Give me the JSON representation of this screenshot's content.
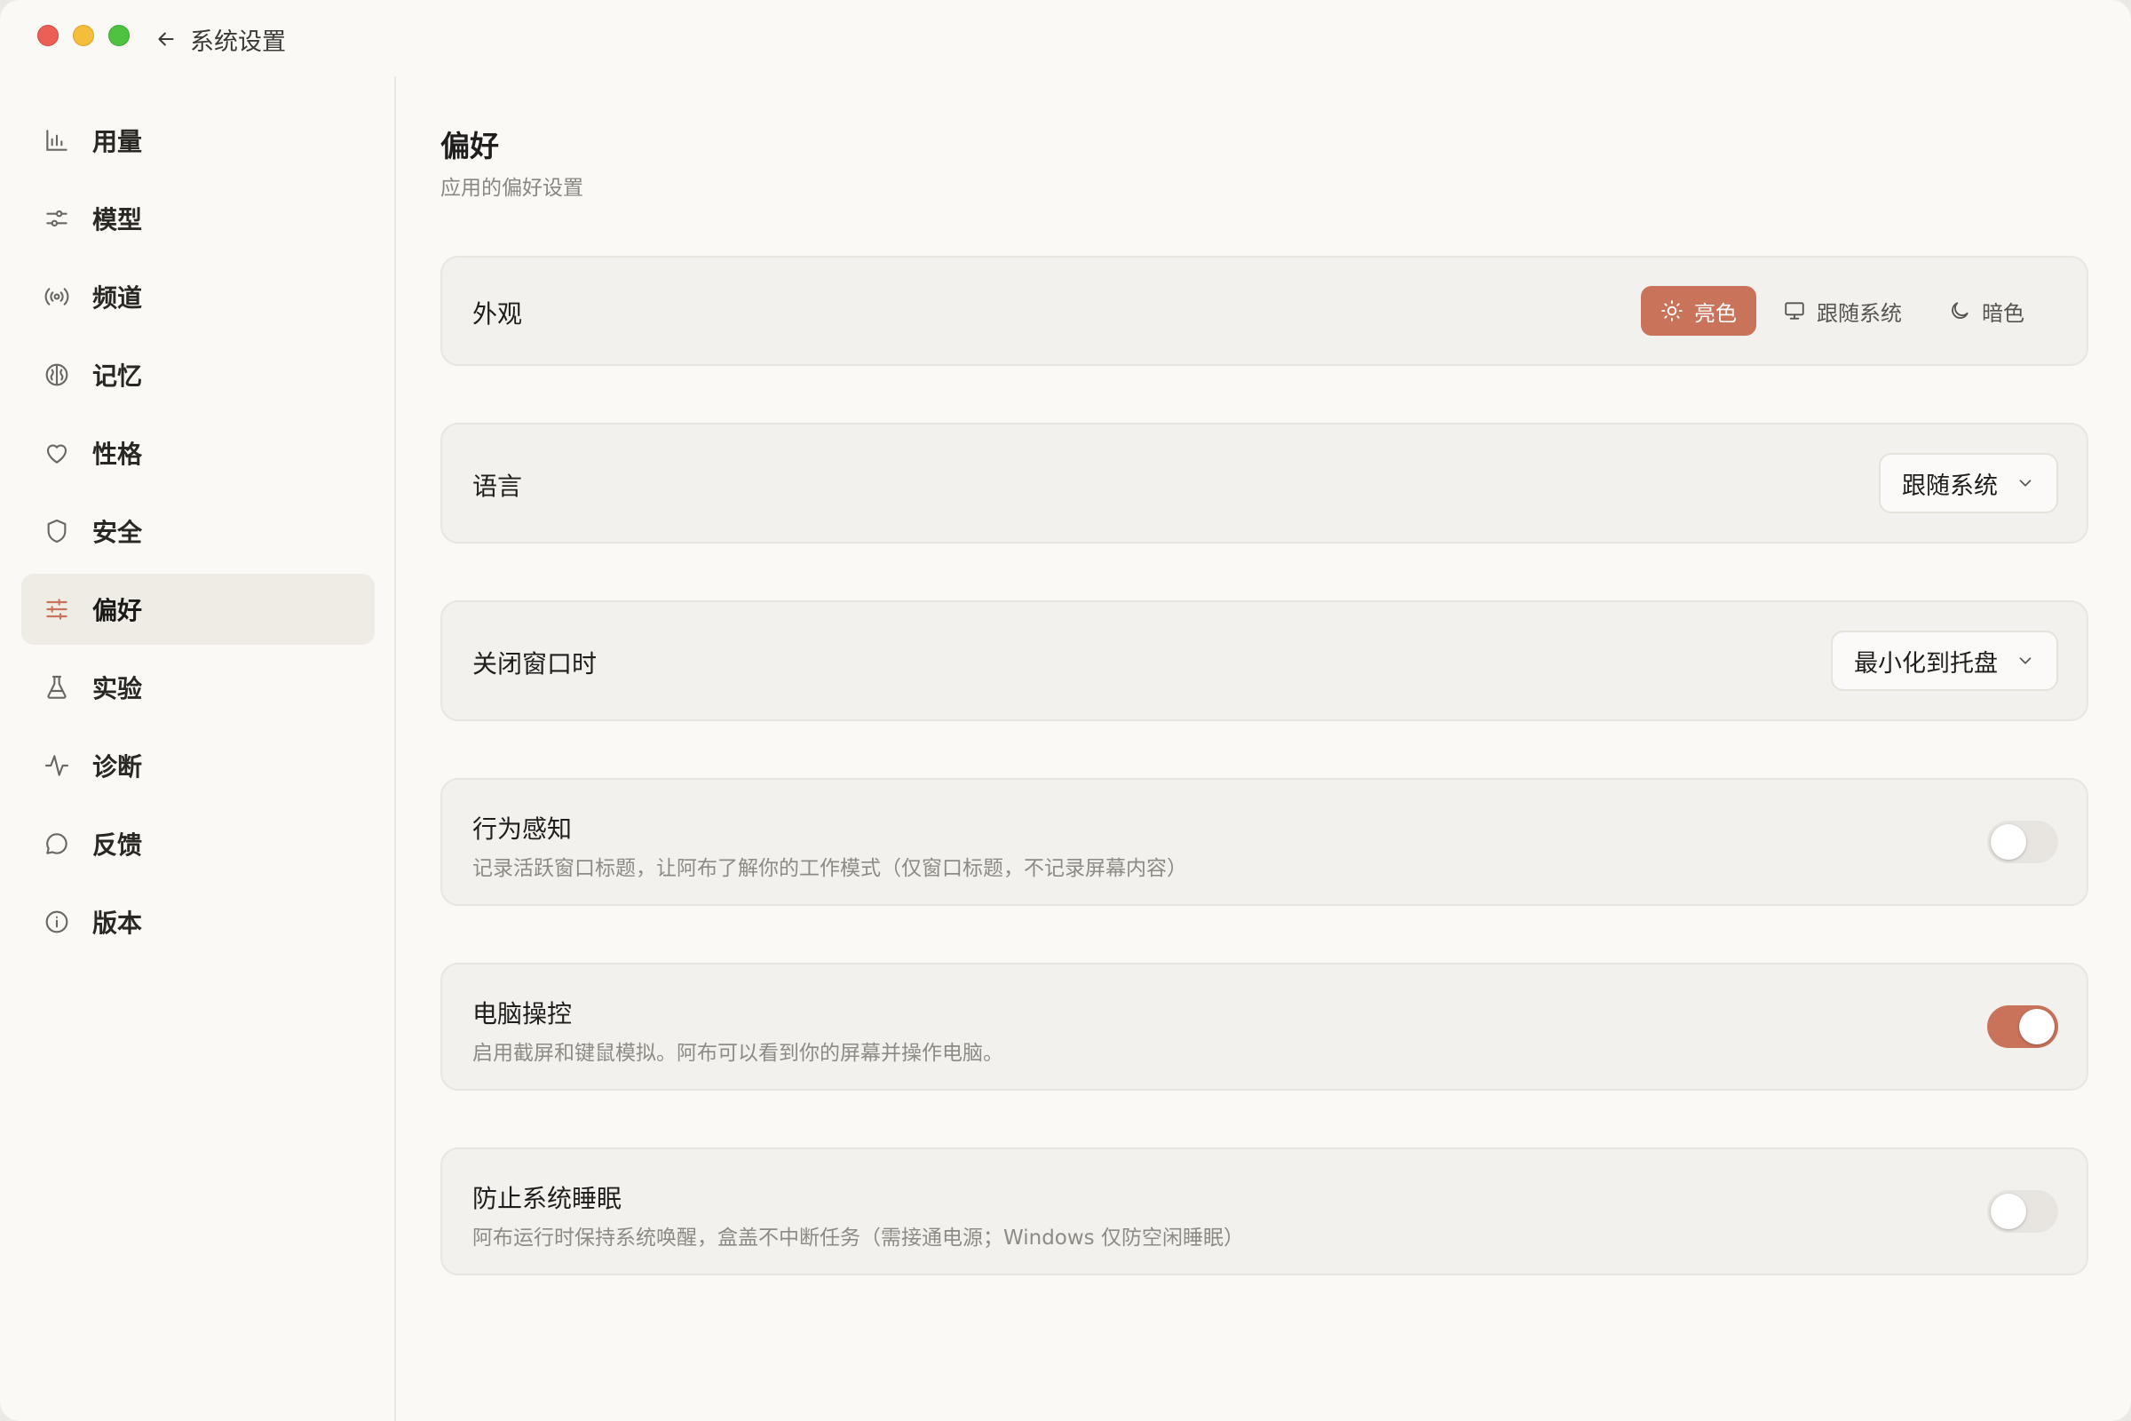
{
  "header": {
    "back_label": "系统设置"
  },
  "sidebar": {
    "items": [
      {
        "label": "用量",
        "icon": "bar-chart-icon"
      },
      {
        "label": "模型",
        "icon": "sliders-icon"
      },
      {
        "label": "频道",
        "icon": "broadcast-icon"
      },
      {
        "label": "记忆",
        "icon": "brain-icon"
      },
      {
        "label": "性格",
        "icon": "heart-icon"
      },
      {
        "label": "安全",
        "icon": "shield-icon"
      },
      {
        "label": "偏好",
        "icon": "preferences-icon",
        "active": true
      },
      {
        "label": "实验",
        "icon": "flask-icon"
      },
      {
        "label": "诊断",
        "icon": "activity-icon"
      },
      {
        "label": "反馈",
        "icon": "chat-bubble-icon"
      },
      {
        "label": "版本",
        "icon": "info-icon"
      }
    ]
  },
  "main": {
    "title": "偏好",
    "subtitle": "应用的偏好设置",
    "appearance": {
      "label": "外观",
      "options": [
        {
          "label": "亮色",
          "icon": "sun-icon",
          "selected": true
        },
        {
          "label": "跟随系统",
          "icon": "monitor-icon",
          "selected": false
        },
        {
          "label": "暗色",
          "icon": "moon-icon",
          "selected": false
        }
      ]
    },
    "language": {
      "label": "语言",
      "value": "跟随系统"
    },
    "close_window": {
      "label": "关闭窗口时",
      "value": "最小化到托盘"
    },
    "behavior_awareness": {
      "label": "行为感知",
      "description": "记录活跃窗口标题，让阿布了解你的工作模式（仅窗口标题，不记录屏幕内容）",
      "enabled": false
    },
    "computer_control": {
      "label": "电脑操控",
      "description": "启用截屏和键鼠模拟。阿布可以看到你的屏幕并操作电脑。",
      "enabled": true
    },
    "prevent_sleep": {
      "label": "防止系统睡眠",
      "description": "阿布运行时保持系统唤醒，盒盖不中断任务（需接通电源；Windows 仅防空闲睡眠）",
      "enabled": false
    }
  },
  "colors": {
    "accent": "#c8735a",
    "background": "#faf9f6",
    "card": "#f3f1ed"
  }
}
